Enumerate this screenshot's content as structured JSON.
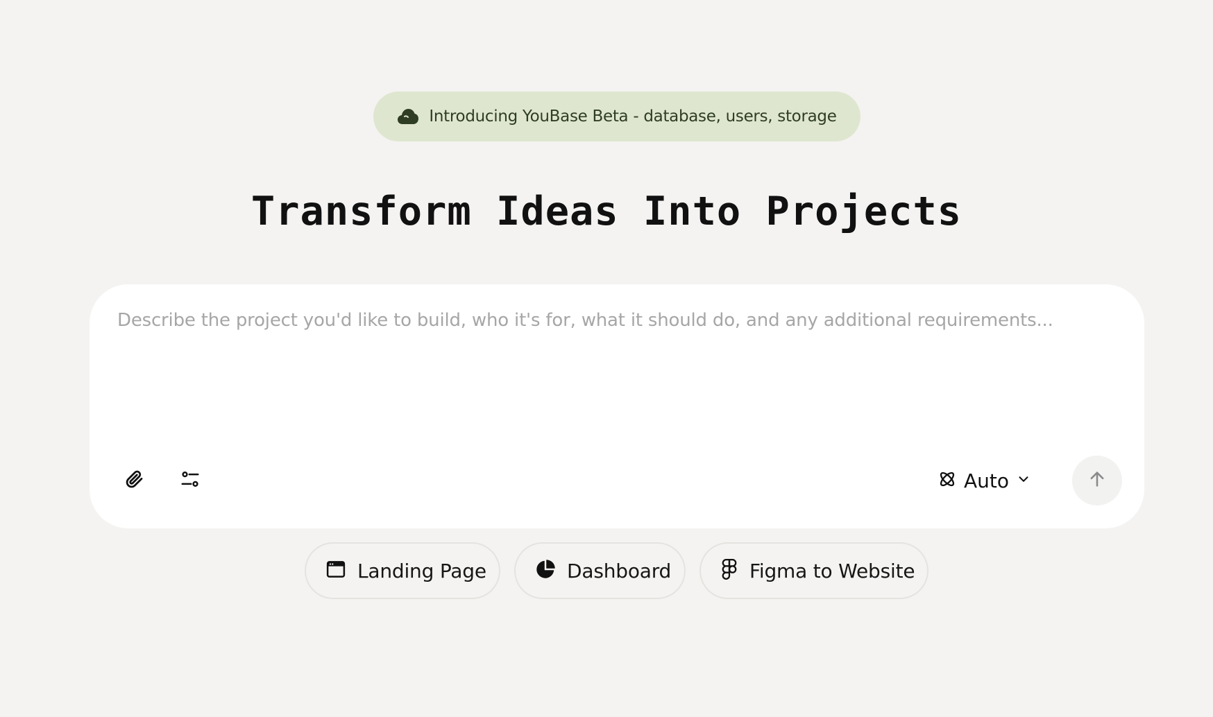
{
  "announcement": {
    "icon": "cloud-icon",
    "text": "Introducing YouBase Beta - database, users, storage"
  },
  "headline": "Transform Ideas Into Projects",
  "composer": {
    "placeholder": "Describe the project you'd like to build, who it's for, what it should do, and any additional requirements...",
    "value": "",
    "attach_icon": "paperclip-icon",
    "settings_icon": "sliders-icon",
    "model": {
      "icon": "atom-icon",
      "selected": "Auto"
    },
    "send_icon": "arrow-up-icon"
  },
  "suggestions": [
    {
      "label": "Landing Page",
      "icon": "browser-window-icon"
    },
    {
      "label": "Dashboard",
      "icon": "pie-chart-icon"
    },
    {
      "label": "Figma to Website",
      "icon": "figma-icon"
    }
  ],
  "colors": {
    "background": "#f4f3f1",
    "announcement_bg": "#dfe6d0",
    "announcement_text": "#2f3d24",
    "composer_bg": "#ffffff",
    "placeholder": "#a6a6a6"
  }
}
